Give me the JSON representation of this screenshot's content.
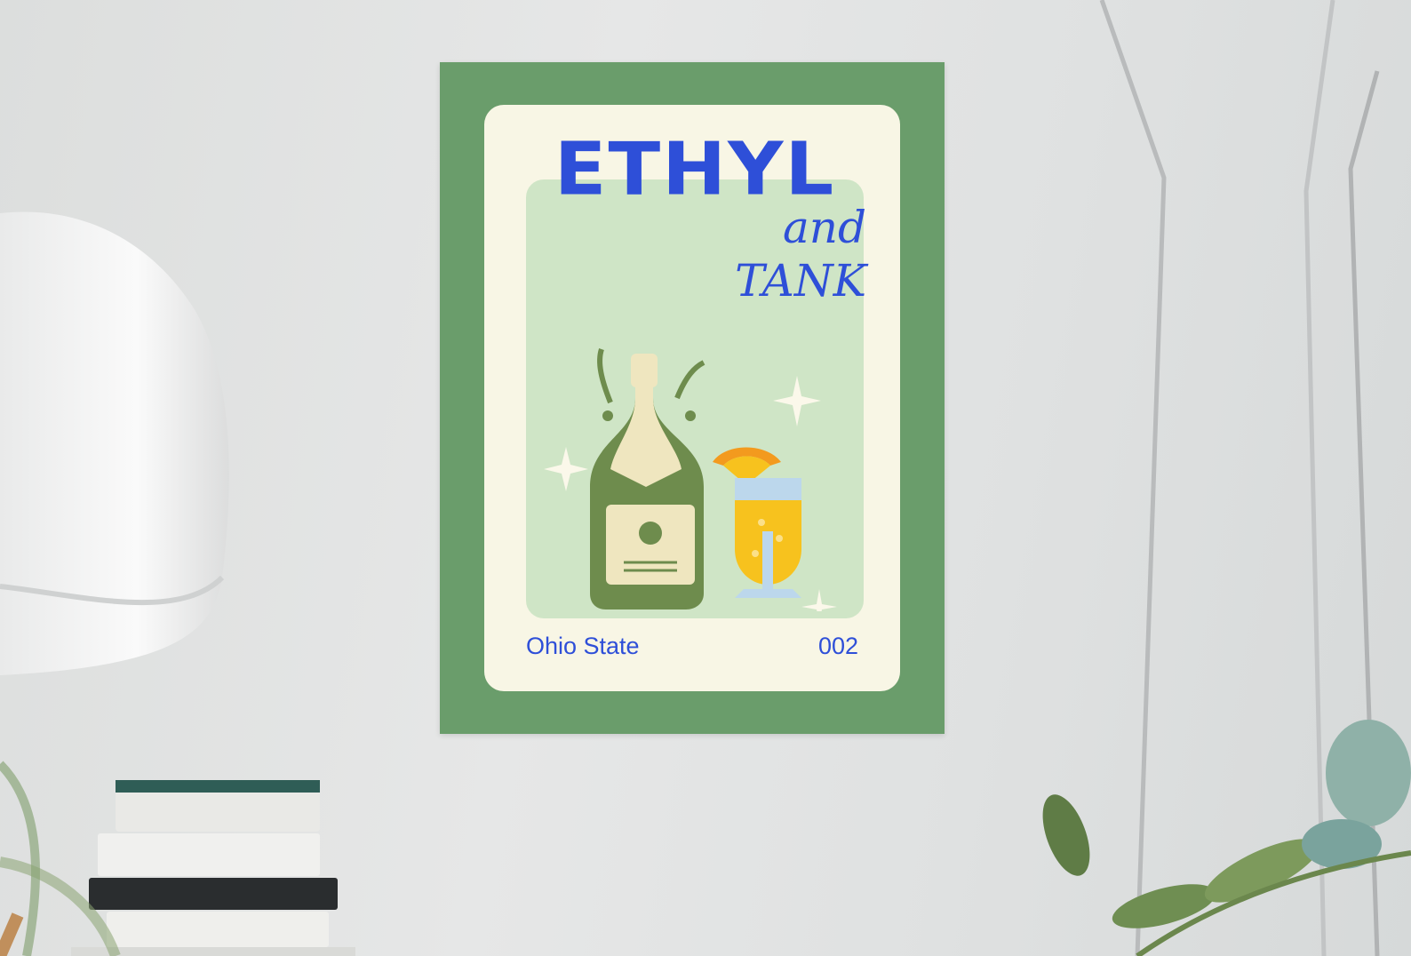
{
  "poster": {
    "title": "ETHYL",
    "subtitle": "and TANK",
    "location": "Ohio State",
    "number": "002"
  },
  "colors": {
    "frame": "#6a9d6b",
    "card": "#f8f6e5",
    "panel": "#cfe5c6",
    "title": "#2e4fd8",
    "bottle": "#6e8c4d",
    "drink": "#f7c21e",
    "orange": "#f39a1e"
  }
}
